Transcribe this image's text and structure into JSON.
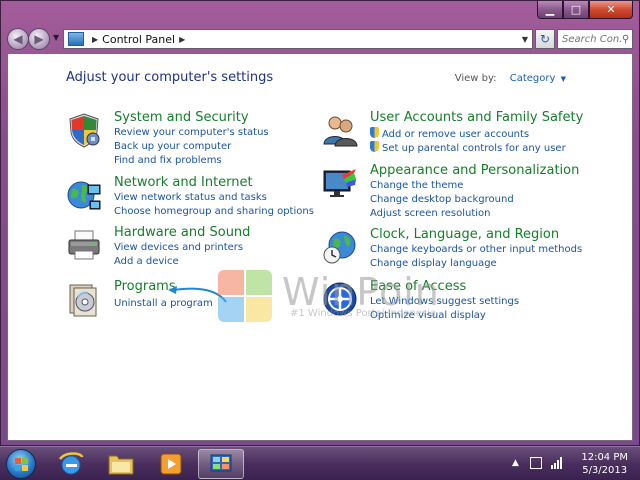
{
  "address_bar": {
    "crumb": "Control Panel"
  },
  "search": {
    "placeholder": "Search Con..."
  },
  "content": {
    "heading": "Adjust your computer's settings",
    "view_by_label": "View by:",
    "view_by_value": "Category"
  },
  "categories": [
    {
      "title": "System and Security",
      "icon": "security-shield-icon",
      "links": [
        "Review your computer's status",
        "Back up your computer",
        "Find and fix problems"
      ]
    },
    {
      "title": "Network and Internet",
      "icon": "network-globe-icon",
      "links": [
        "View network status and tasks",
        "Choose homegroup and sharing options"
      ]
    },
    {
      "title": "Hardware and Sound",
      "icon": "printer-icon",
      "links": [
        "View devices and printers",
        "Add a device"
      ]
    },
    {
      "title": "Programs",
      "icon": "programs-icon",
      "links": [
        "Uninstall a program"
      ]
    },
    {
      "title": "User Accounts and Family Safety",
      "icon": "users-icon",
      "links": [
        "Add or remove user accounts",
        "Set up parental controls for any user"
      ]
    },
    {
      "title": "Appearance and Personalization",
      "icon": "appearance-icon",
      "links": [
        "Change the theme",
        "Change desktop background",
        "Adjust screen resolution"
      ]
    },
    {
      "title": "Clock, Language, and Region",
      "icon": "clock-globe-icon",
      "links": [
        "Change keyboards or other input methods",
        "Change display language"
      ]
    },
    {
      "title": "Ease of Access",
      "icon": "ease-of-access-icon",
      "links": [
        "Let Windows suggest settings",
        "Optimize visual display"
      ]
    }
  ],
  "watermark": {
    "brand": "WinPoin",
    "tagline": "#1 Windows Portal Indonesia"
  },
  "taskbar": {
    "time": "12:04 PM",
    "date": "5/3/2013"
  }
}
